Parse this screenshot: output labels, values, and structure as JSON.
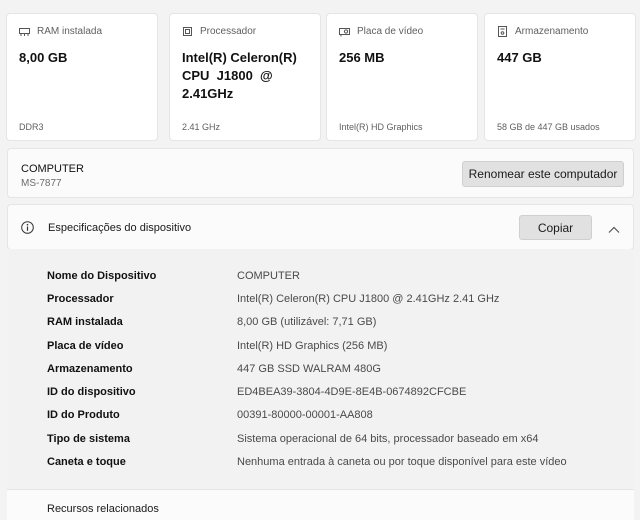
{
  "cards": [
    {
      "icon": "ram-icon",
      "title": "RAM instalada",
      "value": "8,00 GB",
      "foot": "DDR3"
    },
    {
      "icon": "processor-icon",
      "title": "Processador",
      "value": "Intel(R) Celeron(R)\nCPU  J1800  @\n2.41GHz",
      "foot": "2.41 GHz"
    },
    {
      "icon": "gpu-icon",
      "title": "Placa de vídeo",
      "value": "256 MB",
      "foot": "Intel(R) HD Graphics"
    },
    {
      "icon": "storage-icon",
      "title": "Armazenamento",
      "value": "447 GB",
      "foot": "58 GB de 447 GB usados"
    }
  ],
  "computer": {
    "name": "COMPUTER",
    "model": "MS-7877",
    "rename_label": "Renomear este computador"
  },
  "specs": {
    "title": "Especificações do dispositivo",
    "copy_label": "Copiar",
    "rows": [
      {
        "k": "Nome do Dispositivo",
        "v": "COMPUTER"
      },
      {
        "k": "Processador",
        "v": "Intel(R) Celeron(R) CPU  J1800  @ 2.41GHz   2.41 GHz"
      },
      {
        "k": "RAM instalada",
        "v": "8,00 GB (utilizável: 7,71 GB)"
      },
      {
        "k": "Placa de vídeo",
        "v": "Intel(R) HD Graphics (256 MB)"
      },
      {
        "k": "Armazenamento",
        "v": "447 GB SSD WALRAM 480G"
      },
      {
        "k": "ID do dispositivo",
        "v": "ED4BEA39-3804-4D9E-8E4B-0674892CFCBE"
      },
      {
        "k": "ID do Produto",
        "v": "00391-80000-00001-AA808"
      },
      {
        "k": "Tipo de sistema",
        "v": "Sistema operacional de 64 bits, processador baseado em x64"
      },
      {
        "k": "Caneta e toque",
        "v": "Nenhuma entrada à caneta ou por toque disponível para este vídeo"
      }
    ]
  },
  "related": {
    "label": "Recursos relacionados"
  }
}
